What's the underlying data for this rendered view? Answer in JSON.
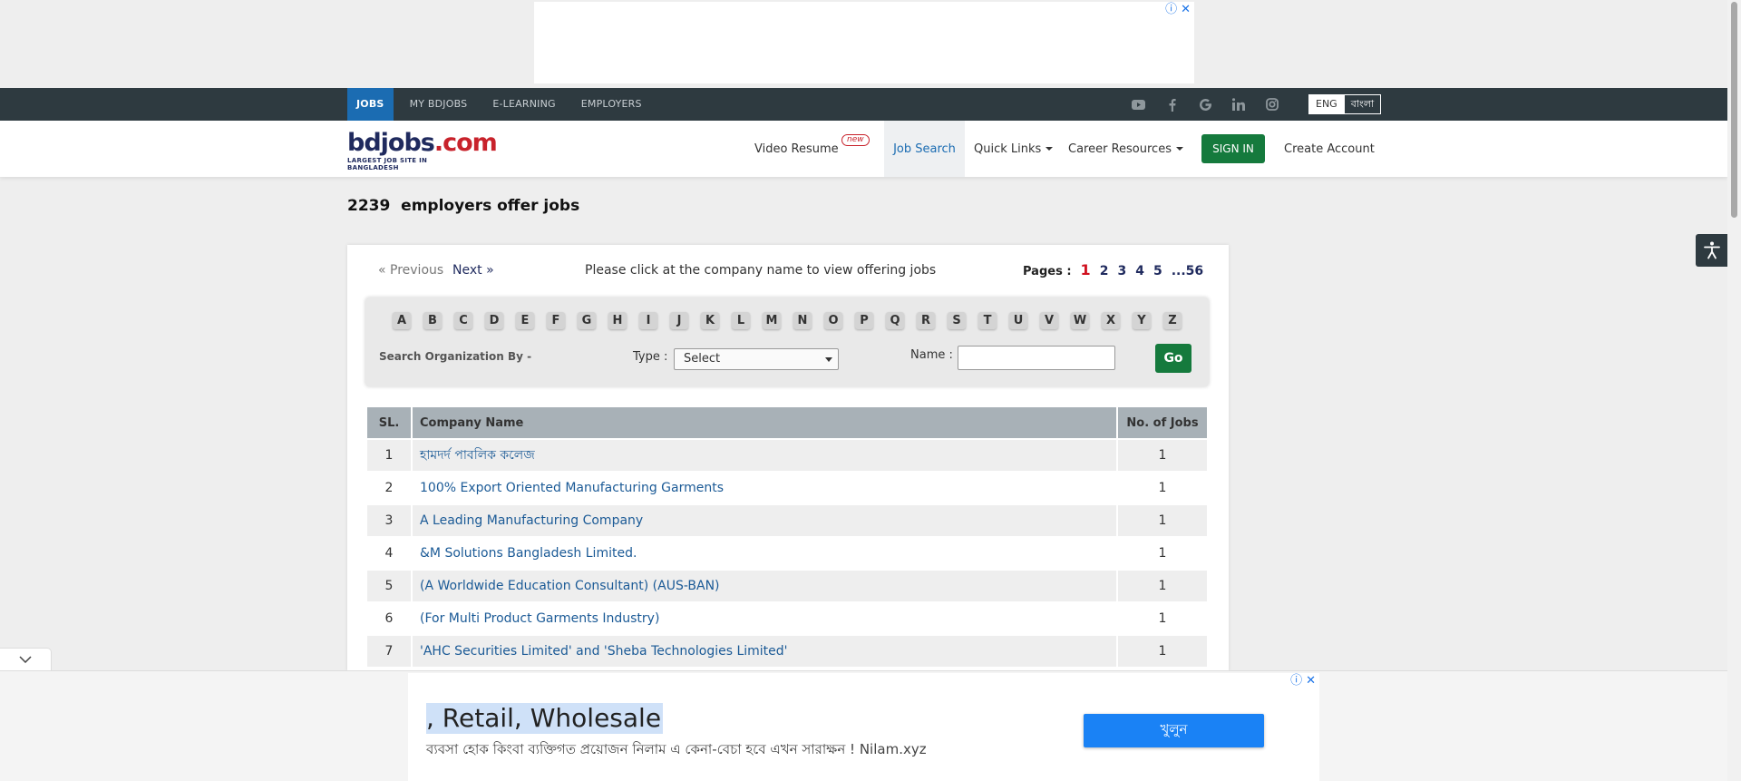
{
  "top_ad": {
    "info_icon": "ⓘ",
    "close_icon": "✕"
  },
  "topnav": {
    "items": [
      {
        "label": "JOBS"
      },
      {
        "label": "MY BDJOBS"
      },
      {
        "label": "E-LEARNING"
      },
      {
        "label": "EMPLOYERS"
      }
    ],
    "social_icons": [
      "youtube-icon",
      "facebook-icon",
      "google-icon",
      "linkedin-icon",
      "instagram-icon"
    ],
    "lang": {
      "eng": "ENG",
      "bn": "বাংলা"
    }
  },
  "header": {
    "logo_main": "bdjobs",
    "logo_suffix": ".com",
    "logo_tagline": "LARGEST JOB SITE IN BANGLADESH",
    "video_resume": "Video Resume",
    "new_badge": "new",
    "job_search": "Job Search",
    "quick_links": "Quick Links",
    "career_resources": "Career Resources",
    "sign_in": "SIGN IN",
    "create_account": "Create Account"
  },
  "heading": {
    "count": "2239",
    "text": "employers offer jobs"
  },
  "pager": {
    "previous": "« Previous",
    "next": "Next »",
    "instruction": "Please click at the company name to view offering jobs",
    "pages_label": "Pages :",
    "pages": [
      "1",
      "2",
      "3",
      "4",
      "5",
      "...56"
    ],
    "current_page": "1"
  },
  "filter": {
    "letters": [
      "A",
      "B",
      "C",
      "D",
      "E",
      "F",
      "G",
      "H",
      "I",
      "J",
      "K",
      "L",
      "M",
      "N",
      "O",
      "P",
      "Q",
      "R",
      "S",
      "T",
      "U",
      "V",
      "W",
      "X",
      "Y",
      "Z"
    ],
    "search_by": "Search Organization By -",
    "type_label": "Type :",
    "type_selected": "Select",
    "name_label": "Name :",
    "name_value": "",
    "go": "Go"
  },
  "table": {
    "headers": {
      "sl": "SL.",
      "company": "Company Name",
      "count": "No. of Jobs"
    },
    "rows": [
      {
        "sl": "1",
        "company": "হামদর্দ পাবলিক কলেজ",
        "jobs": "1"
      },
      {
        "sl": "2",
        "company": "100% Export Oriented Manufacturing Garments",
        "jobs": "1"
      },
      {
        "sl": "3",
        "company": "A Leading Manufacturing Company",
        "jobs": "1"
      },
      {
        "sl": "4",
        "company": "&M Solutions Bangladesh Limited.",
        "jobs": "1"
      },
      {
        "sl": "5",
        "company": "(A Worldwide Education Consultant) (AUS-BAN)",
        "jobs": "1"
      },
      {
        "sl": "6",
        "company": "(For Multi Product Garments Industry)",
        "jobs": "1"
      },
      {
        "sl": "7",
        "company": "'AHC Securities Limited' and 'Sheba Technologies Limited'",
        "jobs": "1"
      }
    ]
  },
  "bottom_ad": {
    "headline": ", Retail, Wholesale",
    "subtext": "ব্যবসা হোক কিংবা ব্যক্তিগত প্রয়োজন নিলাম এ কেনা-বেচা হবে এখন সারাক্ষন ! Nilam.xyz",
    "button": "খুলুন",
    "info_icon": "ⓘ",
    "close_icon": "✕"
  },
  "colors": {
    "topnav_bg": "#2e3a40",
    "active_tab": "#1b6cb2",
    "signin_bg": "#157a3d",
    "link": "#1b5a96",
    "current_page": "#d0101e",
    "ad_button": "#1a82f5"
  }
}
